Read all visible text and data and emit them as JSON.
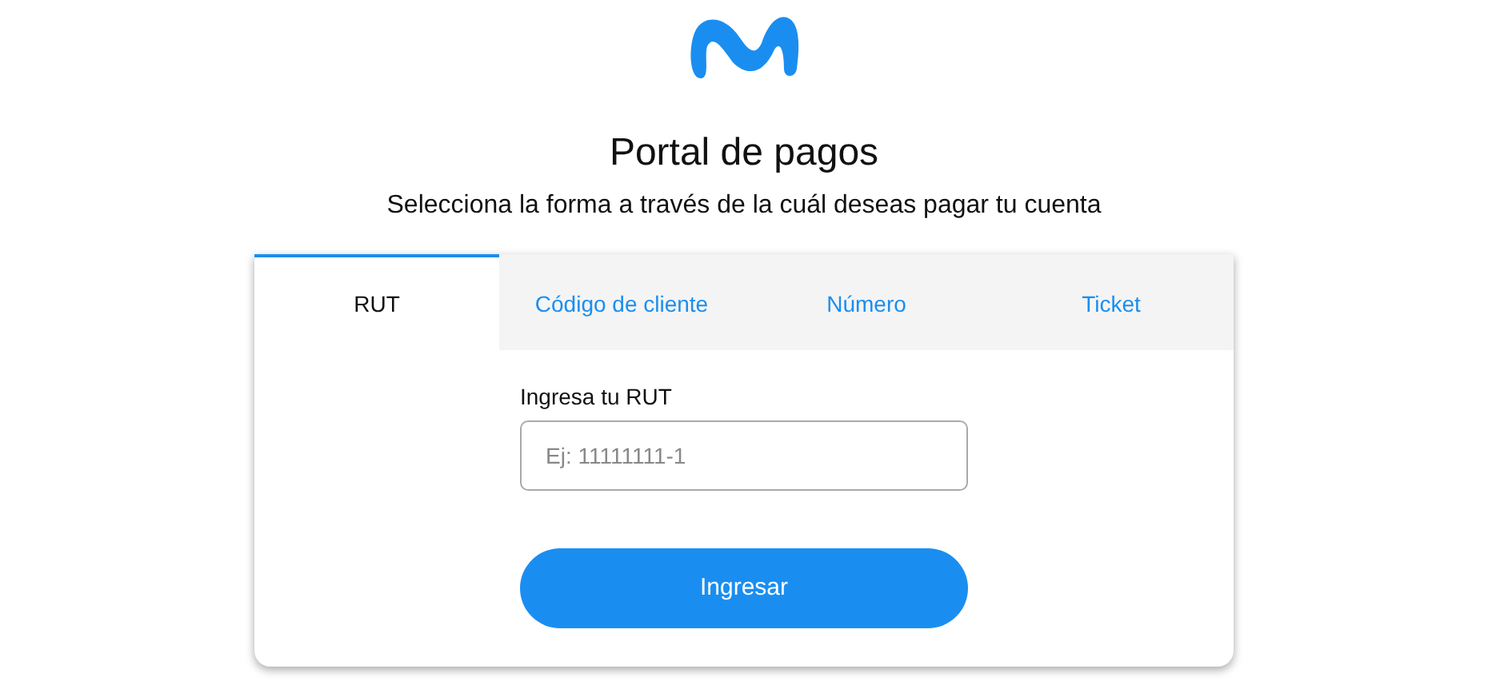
{
  "header": {
    "title": "Portal de pagos",
    "subtitle": "Selecciona la forma a través de la cuál deseas pagar tu cuenta"
  },
  "tabs": [
    {
      "label": "RUT",
      "selected": true
    },
    {
      "label": "Código de cliente",
      "selected": false
    },
    {
      "label": "Número",
      "selected": false
    },
    {
      "label": "Ticket",
      "selected": false
    }
  ],
  "form": {
    "label": "Ingresa tu RUT",
    "placeholder": "Ej: 11111111-1",
    "button": "Ingresar"
  }
}
